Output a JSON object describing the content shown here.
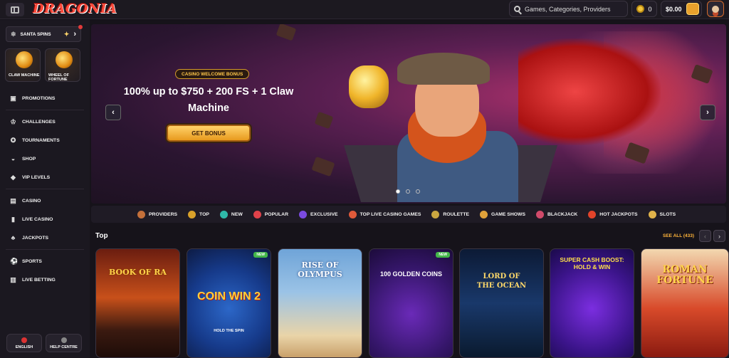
{
  "header": {
    "logo": "DRAGONIA",
    "search_placeholder": "Games, Categories, Providers",
    "coins": "0",
    "balance": "$0.00"
  },
  "sidebar": {
    "promo": "SANTA SPINS",
    "tiles": [
      {
        "label": "CLAW MACHINE"
      },
      {
        "label": "WHEEL OF FORTUNE"
      }
    ],
    "groups": [
      [
        {
          "label": "PROMOTIONS",
          "icon": "gift-icon"
        }
      ],
      [
        {
          "label": "CHALLENGES",
          "icon": "trophy-icon"
        },
        {
          "label": "TOURNAMENTS",
          "icon": "medal-icon"
        },
        {
          "label": "SHOP",
          "icon": "cart-icon"
        },
        {
          "label": "VIP LEVELS",
          "icon": "diamond-icon"
        }
      ],
      [
        {
          "label": "CASINO",
          "icon": "slots-icon"
        },
        {
          "label": "LIVE CASINO",
          "icon": "dealer-icon"
        },
        {
          "label": "JACKPOTS",
          "icon": "clover-icon"
        }
      ],
      [
        {
          "label": "SPORTS",
          "icon": "ball-icon"
        },
        {
          "label": "LIVE BETTING",
          "icon": "live-icon"
        }
      ]
    ],
    "language": "ENGLISH",
    "help": "HELP CENTRE"
  },
  "banner": {
    "tag": "CASINO WELCOME BONUS",
    "title": "100% up to $750 + 200 FS + 1 Claw Machine",
    "cta": "GET BONUS",
    "slides": 3,
    "active_slide": 1
  },
  "categories": [
    {
      "label": "PROVIDERS",
      "color": "#c4703a"
    },
    {
      "label": "TOP",
      "color": "#d9a12a"
    },
    {
      "label": "NEW",
      "color": "#2fb8a8"
    },
    {
      "label": "POPULAR",
      "color": "#e0424a"
    },
    {
      "label": "EXCLUSIVE",
      "color": "#7a4ae0"
    },
    {
      "label": "TOP LIVE CASINO GAMES",
      "color": "#e05a3a"
    },
    {
      "label": "ROULETTE",
      "color": "#c9a640"
    },
    {
      "label": "GAME SHOWS",
      "color": "#e0a23a"
    },
    {
      "label": "BLACKJACK",
      "color": "#d04a6a"
    },
    {
      "label": "HOT JACKPOTS",
      "color": "#e2432a"
    },
    {
      "label": "SLOTS",
      "color": "#e0b24a"
    }
  ],
  "top_section": {
    "title": "Top",
    "see_all": "SEE ALL (433)",
    "games": [
      {
        "title": "BOOK OF RA",
        "badge": ""
      },
      {
        "title": "COIN WIN 2",
        "sub": "HOLD THE SPIN",
        "badge": "NEW"
      },
      {
        "title": "RISE OF OLYMPUS",
        "badge": ""
      },
      {
        "title": "100 GOLDEN COINS",
        "badge": "NEW"
      },
      {
        "title": "LORD OF THE OCEAN",
        "badge": ""
      },
      {
        "title": "SUPER CASH BOOST: HOLD & WIN",
        "badge": ""
      },
      {
        "title": "ROMAN FORTUNE",
        "badge": ""
      }
    ]
  }
}
